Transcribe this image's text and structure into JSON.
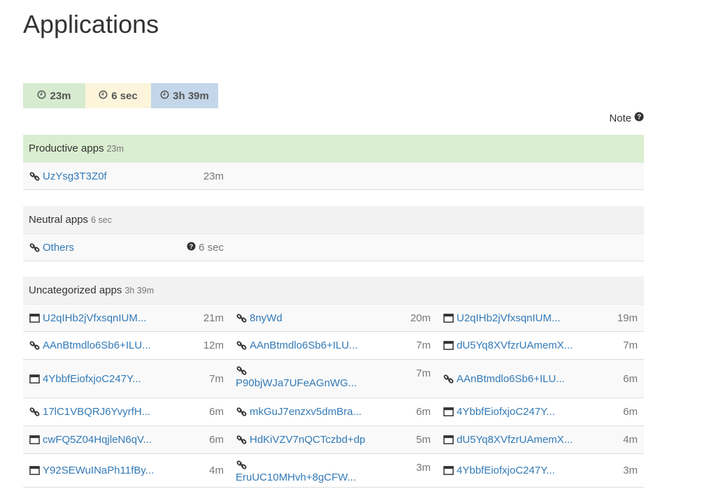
{
  "page": {
    "title": "Applications"
  },
  "summary": {
    "productive": {
      "label": "23m",
      "color": "#d6ebd0"
    },
    "neutral": {
      "label": "6 sec",
      "color": "#fcf5dc"
    },
    "uncategorized": {
      "label": "3h 39m",
      "color": "#c3d6ea"
    }
  },
  "note": {
    "label": "Note"
  },
  "productive": {
    "title": "Productive apps",
    "duration": "23m",
    "header_color": "#d9edcf",
    "items": [
      {
        "icon": "link-icon",
        "name": "UzYsg3T3Z0f",
        "time": "23m"
      }
    ]
  },
  "neutral": {
    "title": "Neutral apps",
    "duration": "6 sec",
    "header_color": "#f2f2f2",
    "items": [
      {
        "icon": "link-icon",
        "name": "Others",
        "time": "6 sec",
        "time_icon": "question-circle-icon"
      }
    ]
  },
  "uncategorized": {
    "title": "Uncategorized apps",
    "duration": "3h 39m",
    "header_color": "#f2f2f2",
    "rows": [
      [
        {
          "icon": "window-icon",
          "name": "U2qIHb2jVfxsqnIUM...",
          "time": "21m"
        },
        {
          "icon": "link-icon",
          "name": "8nyWd",
          "time": "20m"
        },
        {
          "icon": "window-icon",
          "name": "U2qIHb2jVfxsqnIUM...",
          "time": "19m"
        }
      ],
      [
        {
          "icon": "link-icon",
          "name": "AAnBtmdlo6Sb6+ILU...",
          "time": "12m"
        },
        {
          "icon": "link-icon",
          "name": "AAnBtmdlo6Sb6+ILU...",
          "time": "7m"
        },
        {
          "icon": "window-icon",
          "name": "dU5Yq8XVfzrUAmemX...",
          "time": "7m"
        }
      ],
      [
        {
          "icon": "window-icon",
          "name": "4YbbfEiofxjoC247Y...",
          "time": "7m"
        },
        {
          "icon": "link-icon",
          "name": "P90bjWJa7UFeAGnWG...",
          "time": "7m",
          "stacked": true
        },
        {
          "icon": "link-icon",
          "name": "AAnBtmdlo6Sb6+ILU...",
          "time": "6m"
        }
      ],
      [
        {
          "icon": "link-icon",
          "name": "17lC1VBQRJ6YvyrfH...",
          "time": "6m"
        },
        {
          "icon": "link-icon",
          "name": "mkGuJ7enzxv5dmBra...",
          "time": "6m"
        },
        {
          "icon": "window-icon",
          "name": "4YbbfEiofxjoC247Y...",
          "time": "6m"
        }
      ],
      [
        {
          "icon": "window-icon",
          "name": "cwFQ5Z04HqjleN6qV...",
          "time": "6m"
        },
        {
          "icon": "link-icon",
          "name": "HdKiVZV7nQCTczbd+dp",
          "time": "5m"
        },
        {
          "icon": "window-icon",
          "name": "dU5Yq8XVfzrUAmemX...",
          "time": "4m"
        }
      ],
      [
        {
          "icon": "window-icon",
          "name": "Y92SEWuINaPh11fBy...",
          "time": "4m"
        },
        {
          "icon": "link-icon",
          "name": "EruUC10MHvh+8gCFW...",
          "time": "3m",
          "stacked": true
        },
        {
          "icon": "window-icon",
          "name": "4YbbfEiofxjoC247Y...",
          "time": "3m"
        }
      ]
    ]
  }
}
